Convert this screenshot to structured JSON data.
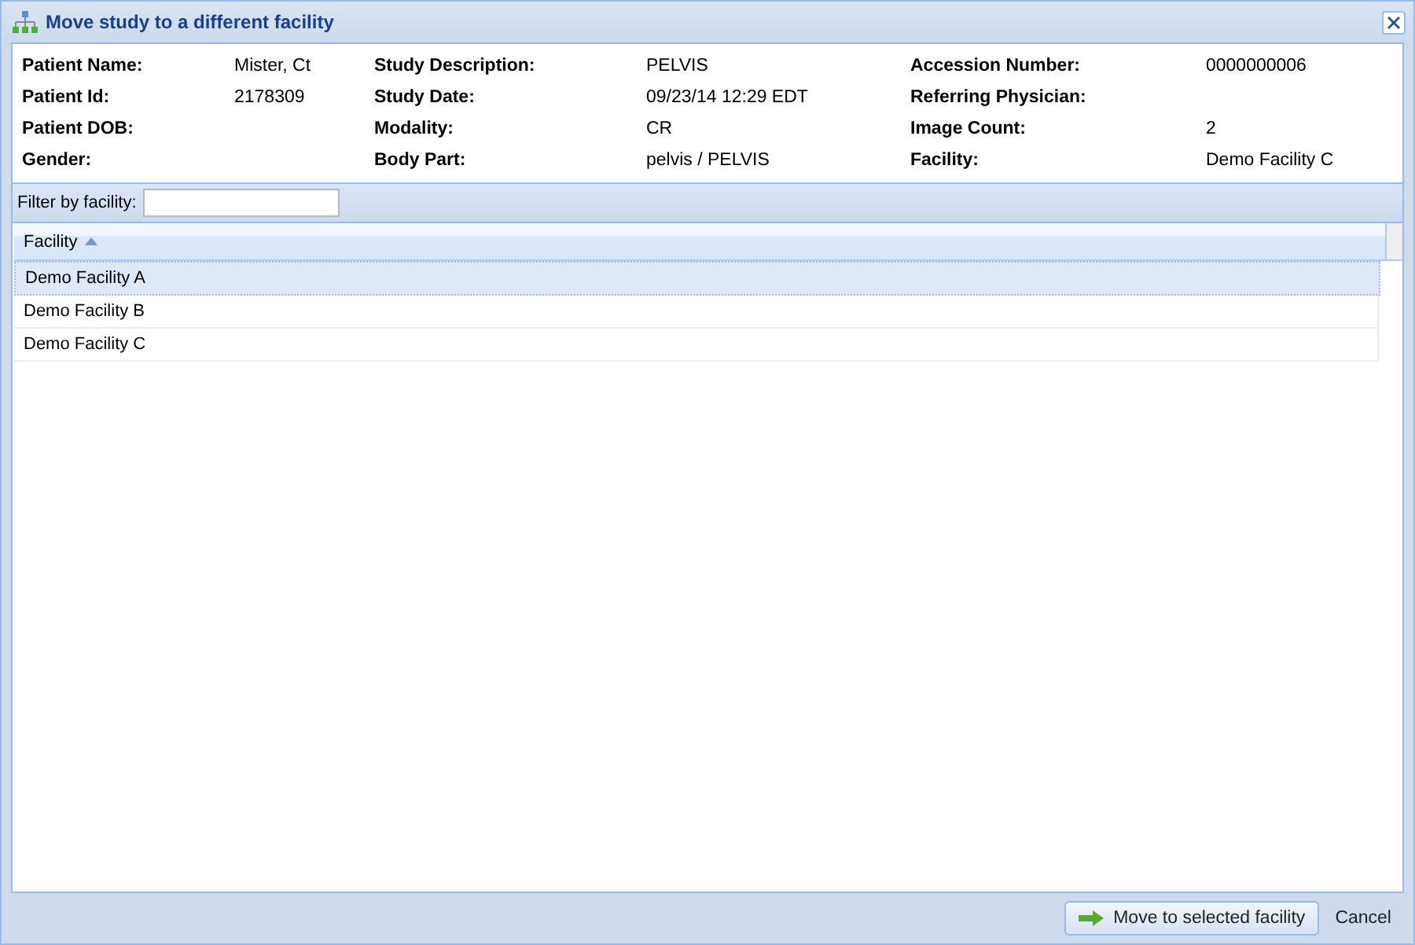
{
  "window": {
    "title": "Move study to a different facility"
  },
  "info": [
    {
      "label": "Patient Name:",
      "value": "Mister, Ct"
    },
    {
      "label": "Study Description:",
      "value": "PELVIS"
    },
    {
      "label": "Accession Number:",
      "value": "0000000006"
    },
    {
      "label": "Patient Id:",
      "value": "2178309"
    },
    {
      "label": "Study Date:",
      "value": "09/23/14 12:29 EDT"
    },
    {
      "label": "Referring Physician:"
    },
    {
      "label": "Patient DOB:"
    },
    {
      "label": "Modality:",
      "value": "CR"
    },
    {
      "label": "Image Count:",
      "value": "2"
    },
    {
      "label": "Gender:"
    },
    {
      "label": "Body Part:",
      "value": "pelvis / PELVIS"
    },
    {
      "label": "Facility:",
      "value": "Demo Facility C"
    }
  ],
  "filter": {
    "label": "Filter by facility:"
  },
  "table": {
    "columns": [
      {
        "label": "Facility",
        "sort_ascending": true
      }
    ],
    "rows": [
      {
        "facility": "Demo Facility A",
        "selected": true
      },
      {
        "facility": "Demo Facility B",
        "selected": false
      },
      {
        "facility": "Demo Facility C",
        "selected": false
      }
    ]
  },
  "buttons": [
    {
      "label": "Move to selected facility",
      "kind": "primary"
    },
    {
      "label": "Cancel",
      "kind": "plain"
    }
  ]
}
